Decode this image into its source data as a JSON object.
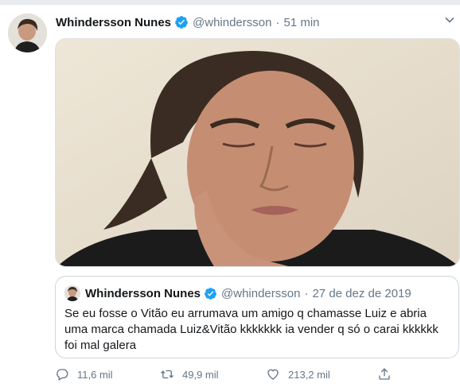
{
  "tweet": {
    "author_name": "Whindersson Nunes",
    "handle": "@whindersson",
    "separator": "·",
    "time": "51 min"
  },
  "quoted_tweet": {
    "author_name": "Whindersson Nunes",
    "handle": "@whindersson",
    "separator": "·",
    "date": "27 de dez de 2019",
    "text": "Se eu fosse o Vitão eu arrumava um amigo q chamasse Luiz e abria uma marca chamada Luiz&Vitão kkkkkkk ia vender q só o carai kkkkkk foi mal galera"
  },
  "actions": {
    "replies": "11,6 mil",
    "retweets": "49,9 mil",
    "likes": "213,2 mil"
  },
  "icons": {
    "verified": "verified-badge-icon",
    "caret": "chevron-down-icon",
    "reply": "reply-icon",
    "retweet": "retweet-icon",
    "like": "heart-icon",
    "share": "share-icon"
  },
  "colors": {
    "verified_blue": "#1da1f2",
    "secondary_text": "#657786",
    "border": "#ccd6dd"
  }
}
